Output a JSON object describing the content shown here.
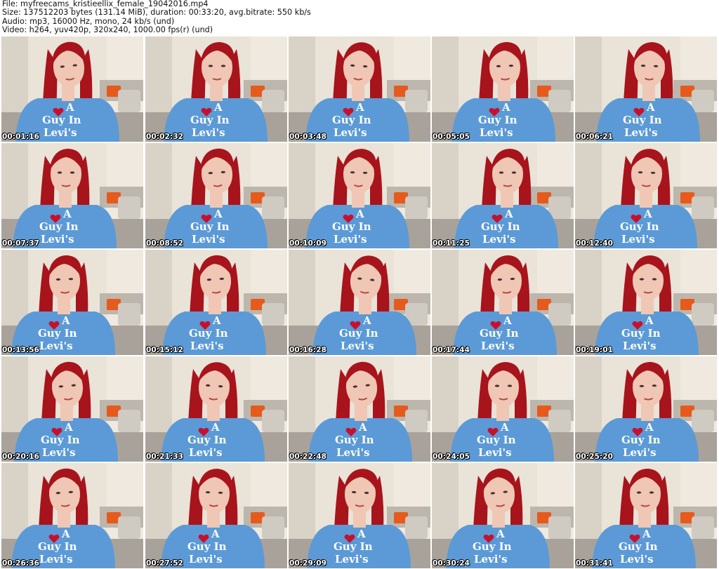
{
  "header": {
    "file_line": "File: myfreecams_kristieellix_female_19042016.mp4",
    "size_line": "Size: 137512203 bytes (131.14 MiB), duration: 00:33:20, avg.bitrate: 550 kb/s",
    "audio_line": "Audio: mp3, 16000 Hz, mono, 24 kb/s (und)",
    "video_line": "Video: h264, yuv420p, 320x240, 1000.00 fps(r) (und)"
  },
  "colors": {
    "wall": "#e9e3d8",
    "shirt": "#5b9ad6",
    "hair": "#a8141c",
    "skin": "#efc7b4",
    "pillow_orange": "#e65a1c",
    "pillow_gray": "#cfcac2",
    "sofa": "#bdb6ad"
  },
  "shirt_text": {
    "line1": "A",
    "line2": "Guy In",
    "line3": "Levi's"
  },
  "thumbnails": [
    {
      "time": "00:01:16"
    },
    {
      "time": "00:02:32"
    },
    {
      "time": "00:03:48"
    },
    {
      "time": "00:05:05"
    },
    {
      "time": "00:06:21"
    },
    {
      "time": "00:07:37"
    },
    {
      "time": "00:08:52"
    },
    {
      "time": "00:10:09"
    },
    {
      "time": "00:11:25"
    },
    {
      "time": "00:12:40"
    },
    {
      "time": "00:13:56"
    },
    {
      "time": "00:15:12"
    },
    {
      "time": "00:16:28"
    },
    {
      "time": "00:17:44"
    },
    {
      "time": "00:19:01"
    },
    {
      "time": "00:20:16"
    },
    {
      "time": "00:21:33"
    },
    {
      "time": "00:22:48"
    },
    {
      "time": "00:24:05"
    },
    {
      "time": "00:25:20"
    },
    {
      "time": "00:26:36"
    },
    {
      "time": "00:27:52"
    },
    {
      "time": "00:29:09"
    },
    {
      "time": "00:30:24"
    },
    {
      "time": "00:31:41"
    }
  ]
}
